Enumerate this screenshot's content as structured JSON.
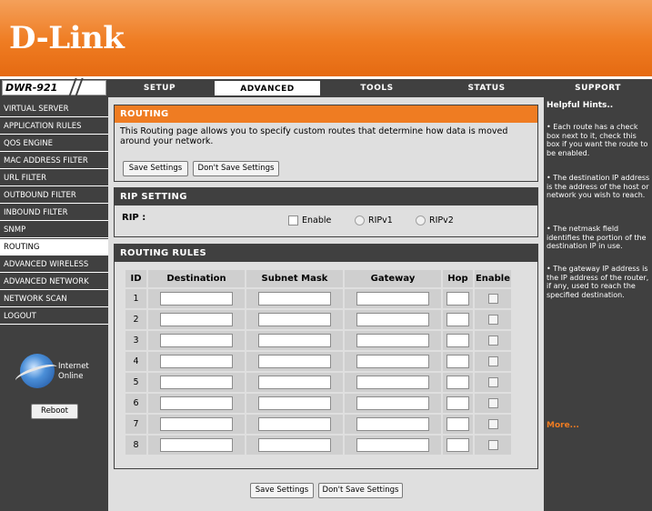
{
  "brand": {
    "logo_text": "D-Link",
    "model": "DWR-921"
  },
  "colors": {
    "accent": "#ef7c22",
    "dark": "#404040",
    "panel": "#dfdfdf"
  },
  "tabs": [
    {
      "label": "SETUP"
    },
    {
      "label": "ADVANCED"
    },
    {
      "label": "TOOLS"
    },
    {
      "label": "STATUS"
    },
    {
      "label": "SUPPORT"
    }
  ],
  "sidebar": {
    "items": [
      {
        "label": "VIRTUAL SERVER"
      },
      {
        "label": "APPLICATION RULES"
      },
      {
        "label": "QOS ENGINE"
      },
      {
        "label": "MAC ADDRESS FILTER"
      },
      {
        "label": "URL FILTER"
      },
      {
        "label": "OUTBOUND FILTER"
      },
      {
        "label": "INBOUND FILTER"
      },
      {
        "label": "SNMP"
      },
      {
        "label": "ROUTING"
      },
      {
        "label": "ADVANCED WIRELESS"
      },
      {
        "label": "ADVANCED NETWORK"
      },
      {
        "label": "NETWORK SCAN"
      },
      {
        "label": "LOGOUT"
      }
    ],
    "internet_status_line1": "Internet",
    "internet_status_line2": "Online",
    "reboot_label": "Reboot"
  },
  "routing": {
    "title": "ROUTING",
    "description": "This Routing page allows you to specify custom routes that determine how data is moved around your network.",
    "save_label": "Save Settings",
    "dont_save_label": "Don't Save Settings"
  },
  "rip": {
    "title": "RIP SETTING",
    "label": "RIP :",
    "enable_label": "Enable",
    "ripv1_label": "RIPv1",
    "ripv2_label": "RIPv2"
  },
  "rules": {
    "title": "ROUTING RULES",
    "headers": {
      "id": "ID",
      "destination": "Destination",
      "subnet": "Subnet Mask",
      "gateway": "Gateway",
      "hop": "Hop",
      "enable": "Enable"
    },
    "rows": [
      "1",
      "2",
      "3",
      "4",
      "5",
      "6",
      "7",
      "8"
    ]
  },
  "footer": {
    "save_label": "Save Settings",
    "dont_save_label": "Don't Save Settings"
  },
  "hints": {
    "title": "Helpful Hints..",
    "items": [
      "• Each route has a check box next to it, check this box if you want the route to be enabled.",
      "• The destination IP address is the address of the host or network you wish to reach.",
      "• The netmask field identifies the portion of the destination IP in use.",
      "• The gateway IP address is the IP address of the router, if any, used to reach the specified destination."
    ],
    "more_label": "More..."
  }
}
